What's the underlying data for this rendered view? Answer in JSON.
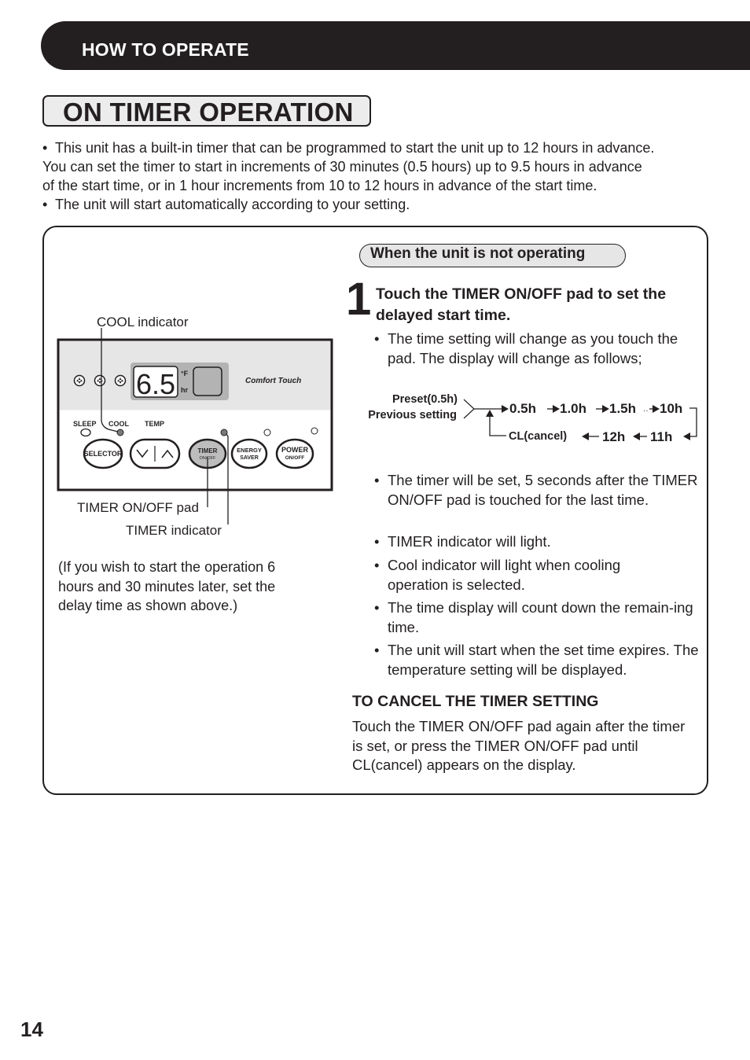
{
  "header": {
    "section": "HOW TO OPERATE"
  },
  "title": "ON TIMER OPERATION",
  "intro": {
    "bullets": [
      [
        "This unit has a built-in timer that can be programmed to start the unit up to 12 hours in advance.",
        "You can set the timer to start in increments of 30 minutes (0.5 hours) up to 9.5 hours in advance",
        "of the start time, or in 1 hour increments from 10 to 12 hours in advance of the start time."
      ],
      [
        "The unit will start automatically according to your setting."
      ]
    ]
  },
  "panel": {
    "display_value": "6.5",
    "unit_f": "°F",
    "unit_hr": "hr",
    "brand": "Comfort Touch",
    "labels": {
      "sleep": "SLEEP",
      "cool": "COOL",
      "temp": "TEMP"
    },
    "buttons": {
      "selector": "SELECTOR",
      "timer": [
        "TIMER",
        "ON/OFF"
      ],
      "energy": [
        "ENERGY",
        "SAVER"
      ],
      "power": [
        "POWER",
        "ON/OFF"
      ]
    },
    "callouts": {
      "cool_indicator": "COOL indicator",
      "timer_pad": "TIMER ON/OFF pad",
      "timer_indicator": "TIMER indicator"
    }
  },
  "note": "(If you wish to start the operation 6 hours and 30 minutes later, set the delay time as shown above.)",
  "condition": "When the unit is not operating",
  "step": {
    "number": "1",
    "title": "Touch the TIMER ON/OFF pad to set the delayed start time.",
    "bullet_first": "The time setting will change as you touch the pad. The display will change as follows;",
    "bullets": [
      "The timer will be set, 5 seconds after the TIMER ON/OFF pad is touched for the last time.",
      "TIMER indicator will light.",
      "Cool indicator will light when cooling operation is selected.",
      "The time display will count down the remain-ing time.",
      "The unit will start when the set time expires. The temperature setting will be displayed."
    ]
  },
  "flow": {
    "start_labels": [
      "Preset(0.5h)",
      "Previous setting"
    ],
    "top_row": [
      "0.5h",
      "1.0h",
      "1.5h",
      "10h"
    ],
    "bottom_row": [
      "CL(cancel)",
      "12h",
      "11h"
    ]
  },
  "cancel": {
    "heading": "TO CANCEL THE TIMER SETTING",
    "text": "Touch the TIMER ON/OFF pad again after the timer is set, or press the TIMER ON/OFF pad until CL(cancel) appears on the display."
  },
  "page_number": "14",
  "bullet_char": "•"
}
